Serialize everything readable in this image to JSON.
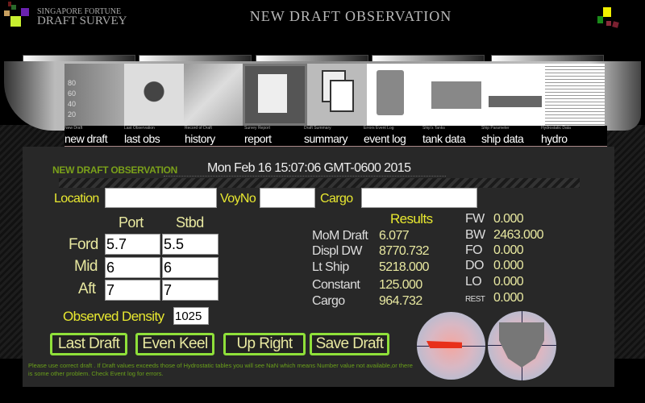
{
  "header": {
    "brand_top": "SINGAPORE FORTUNE",
    "brand_bottom": "DRAFT SURVEY",
    "title": "NEW DRAFT OBSERVATION"
  },
  "nav": [
    {
      "caption": "New Draft",
      "label": "new draft"
    },
    {
      "caption": "Last Observation",
      "label": "last obs"
    },
    {
      "caption": "Record of Draft",
      "label": "history"
    },
    {
      "caption": "Survey Report",
      "label": "report"
    },
    {
      "caption": "Draft Summary",
      "label": "summary"
    },
    {
      "caption": "Errors Event Log",
      "label": "event log"
    },
    {
      "caption": "Ship's Tanks",
      "label": "tank data"
    },
    {
      "caption": "Ship Parameter",
      "label": "ship data"
    },
    {
      "caption": "Hydrostatic Data",
      "label": "hydro"
    }
  ],
  "form": {
    "section_title": "NEW DRAFT OBSERVATION",
    "datetime": "Mon Feb 16 15:07:06 GMT-0600 2015",
    "location_label": "Location",
    "location_value": "",
    "voyno_label": "VoyNo",
    "voyno_value": "",
    "cargo_label": "Cargo",
    "cargo_value": "",
    "port_label": "Port",
    "stbd_label": "Stbd",
    "rows": [
      {
        "label": "Ford",
        "port": "5.7",
        "stbd": "5.5"
      },
      {
        "label": "Mid",
        "port": "6",
        "stbd": "6"
      },
      {
        "label": "Aft",
        "port": "7",
        "stbd": "7"
      }
    ],
    "density_label": "Observed Density",
    "density_value": "1025"
  },
  "results": {
    "title": "Results",
    "items": [
      {
        "label": "MoM Draft",
        "value": "6.077"
      },
      {
        "label": "Displ DW",
        "value": "8770.732"
      },
      {
        "label": "Lt Ship",
        "value": "5218.000"
      },
      {
        "label": "Constant",
        "value": "125.000"
      },
      {
        "label": "Cargo",
        "value": "964.732"
      }
    ],
    "tanks": [
      {
        "label": "FW",
        "value": "0.000"
      },
      {
        "label": "BW",
        "value": "2463.000"
      },
      {
        "label": "FO",
        "value": "0.000"
      },
      {
        "label": "DO",
        "value": "0.000"
      },
      {
        "label": "LO",
        "value": "0.000"
      },
      {
        "label": "REST",
        "value": "0.000"
      }
    ]
  },
  "buttons": {
    "last_draft": "Last Draft",
    "even_keel": "Even Keel",
    "up_right": "Up Right",
    "save_draft": "Save Draft"
  },
  "note": "Please use correct draft . If Draft values exceeds those of Hydrostatic tables you will see NaN which means Number value not available,or there is some other problem. Check Event log for errors.",
  "colors": {
    "accent_green": "#8fe03a",
    "label_yellow": "#e8e830",
    "value_cream": "#e8e8a0",
    "panel": "#282828"
  }
}
